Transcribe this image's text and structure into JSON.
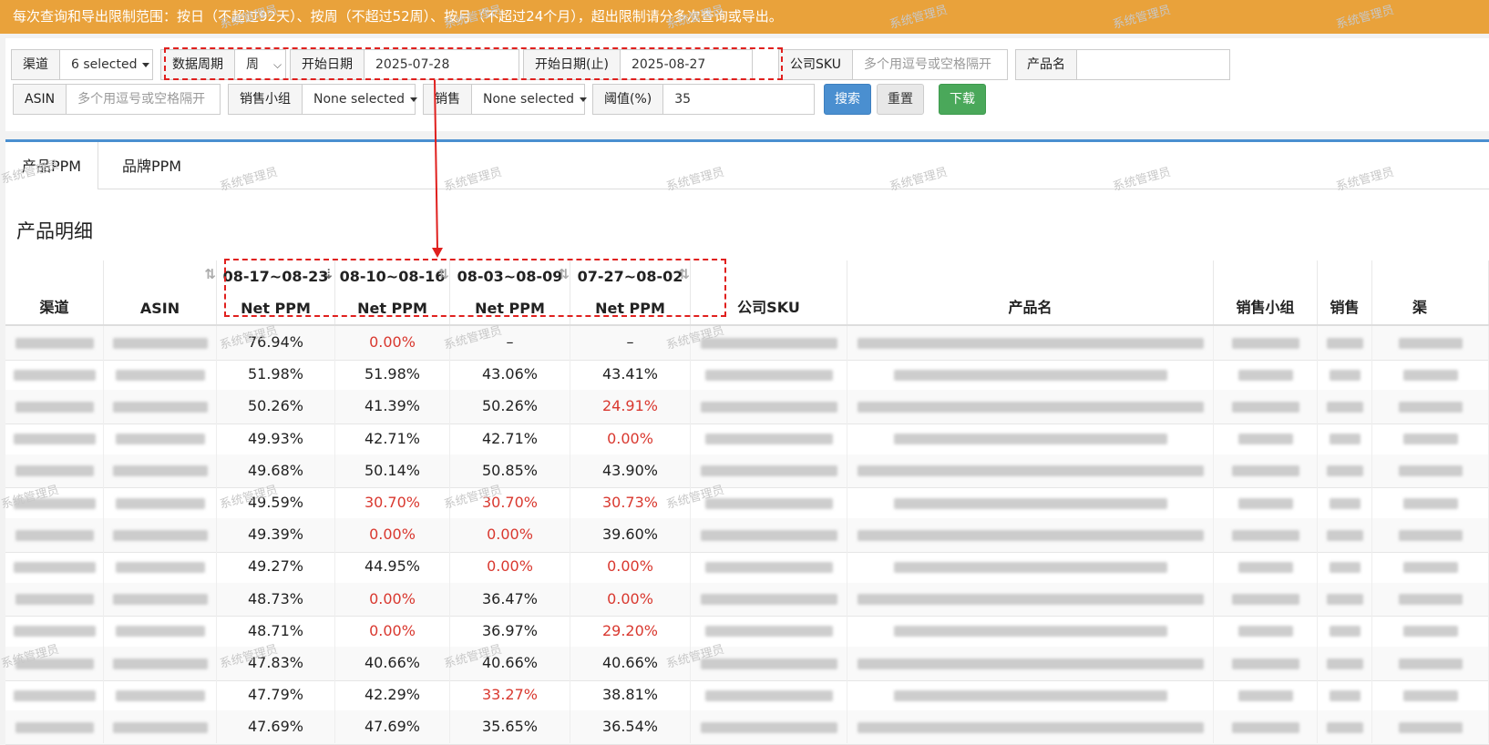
{
  "notice": "每次查询和导出限制范围：按日（不超过92天）、按周（不超过52周）、按月（不超过24个月），超出限制请分多次查询或导出。",
  "filters": {
    "channel": {
      "label": "渠道",
      "value": "6 selected"
    },
    "period": {
      "label": "数据周期",
      "value": "周"
    },
    "start_date": {
      "label": "开始日期",
      "value": "2025-07-28"
    },
    "end_date": {
      "label": "开始日期(止)",
      "value": "2025-08-27"
    },
    "company_sku": {
      "label": "公司SKU",
      "placeholder": "多个用逗号或空格隔开"
    },
    "product_name": {
      "label": "产品名",
      "value": ""
    },
    "asin": {
      "label": "ASIN",
      "placeholder": "多个用逗号或空格隔开"
    },
    "sales_group": {
      "label": "销售小组",
      "value": "None selected"
    },
    "sales": {
      "label": "销售",
      "value": "None selected"
    },
    "threshold": {
      "label": "阈值(%)",
      "value": "35"
    }
  },
  "buttons": {
    "search": "搜索",
    "reset": "重置",
    "download": "下载"
  },
  "tabs": [
    "产品PPM",
    "品牌PPM"
  ],
  "section_title": "产品明细",
  "table": {
    "headers": {
      "channel": "渠道",
      "asin": "ASIN",
      "weeks": [
        {
          "range": "08-17~08-23",
          "metric": "Net PPM"
        },
        {
          "range": "08-10~08-16",
          "metric": "Net PPM"
        },
        {
          "range": "08-03~08-09",
          "metric": "Net PPM"
        },
        {
          "range": "07-27~08-02",
          "metric": "Net PPM"
        }
      ],
      "sku": "公司SKU",
      "product": "产品名",
      "group": "销售小组",
      "sales": "销售",
      "extra": "渠"
    },
    "rows": [
      [
        "76.94%",
        "0.00%",
        "–",
        "–"
      ],
      [
        "51.98%",
        "51.98%",
        "43.06%",
        "43.41%"
      ],
      [
        "50.26%",
        "41.39%",
        "50.26%",
        "24.91%"
      ],
      [
        "49.93%",
        "42.71%",
        "42.71%",
        "0.00%"
      ],
      [
        "49.68%",
        "50.14%",
        "50.85%",
        "43.90%"
      ],
      [
        "49.59%",
        "30.70%",
        "30.70%",
        "30.73%"
      ],
      [
        "49.39%",
        "0.00%",
        "0.00%",
        "39.60%"
      ],
      [
        "49.27%",
        "44.95%",
        "0.00%",
        "0.00%"
      ],
      [
        "48.73%",
        "0.00%",
        "36.47%",
        "0.00%"
      ],
      [
        "48.71%",
        "0.00%",
        "36.97%",
        "29.20%"
      ],
      [
        "47.83%",
        "40.66%",
        "40.66%",
        "40.66%"
      ],
      [
        "47.79%",
        "42.29%",
        "33.27%",
        "38.81%"
      ],
      [
        "47.69%",
        "47.69%",
        "35.65%",
        "36.54%"
      ]
    ],
    "threshold_pct": 35
  },
  "watermark": "系统管理员",
  "colors": {
    "notice": "#e9a23b",
    "red": "#d9382f",
    "search": "#4a8fd0",
    "download": "#4aa85a",
    "annotation": "#e0201e"
  }
}
